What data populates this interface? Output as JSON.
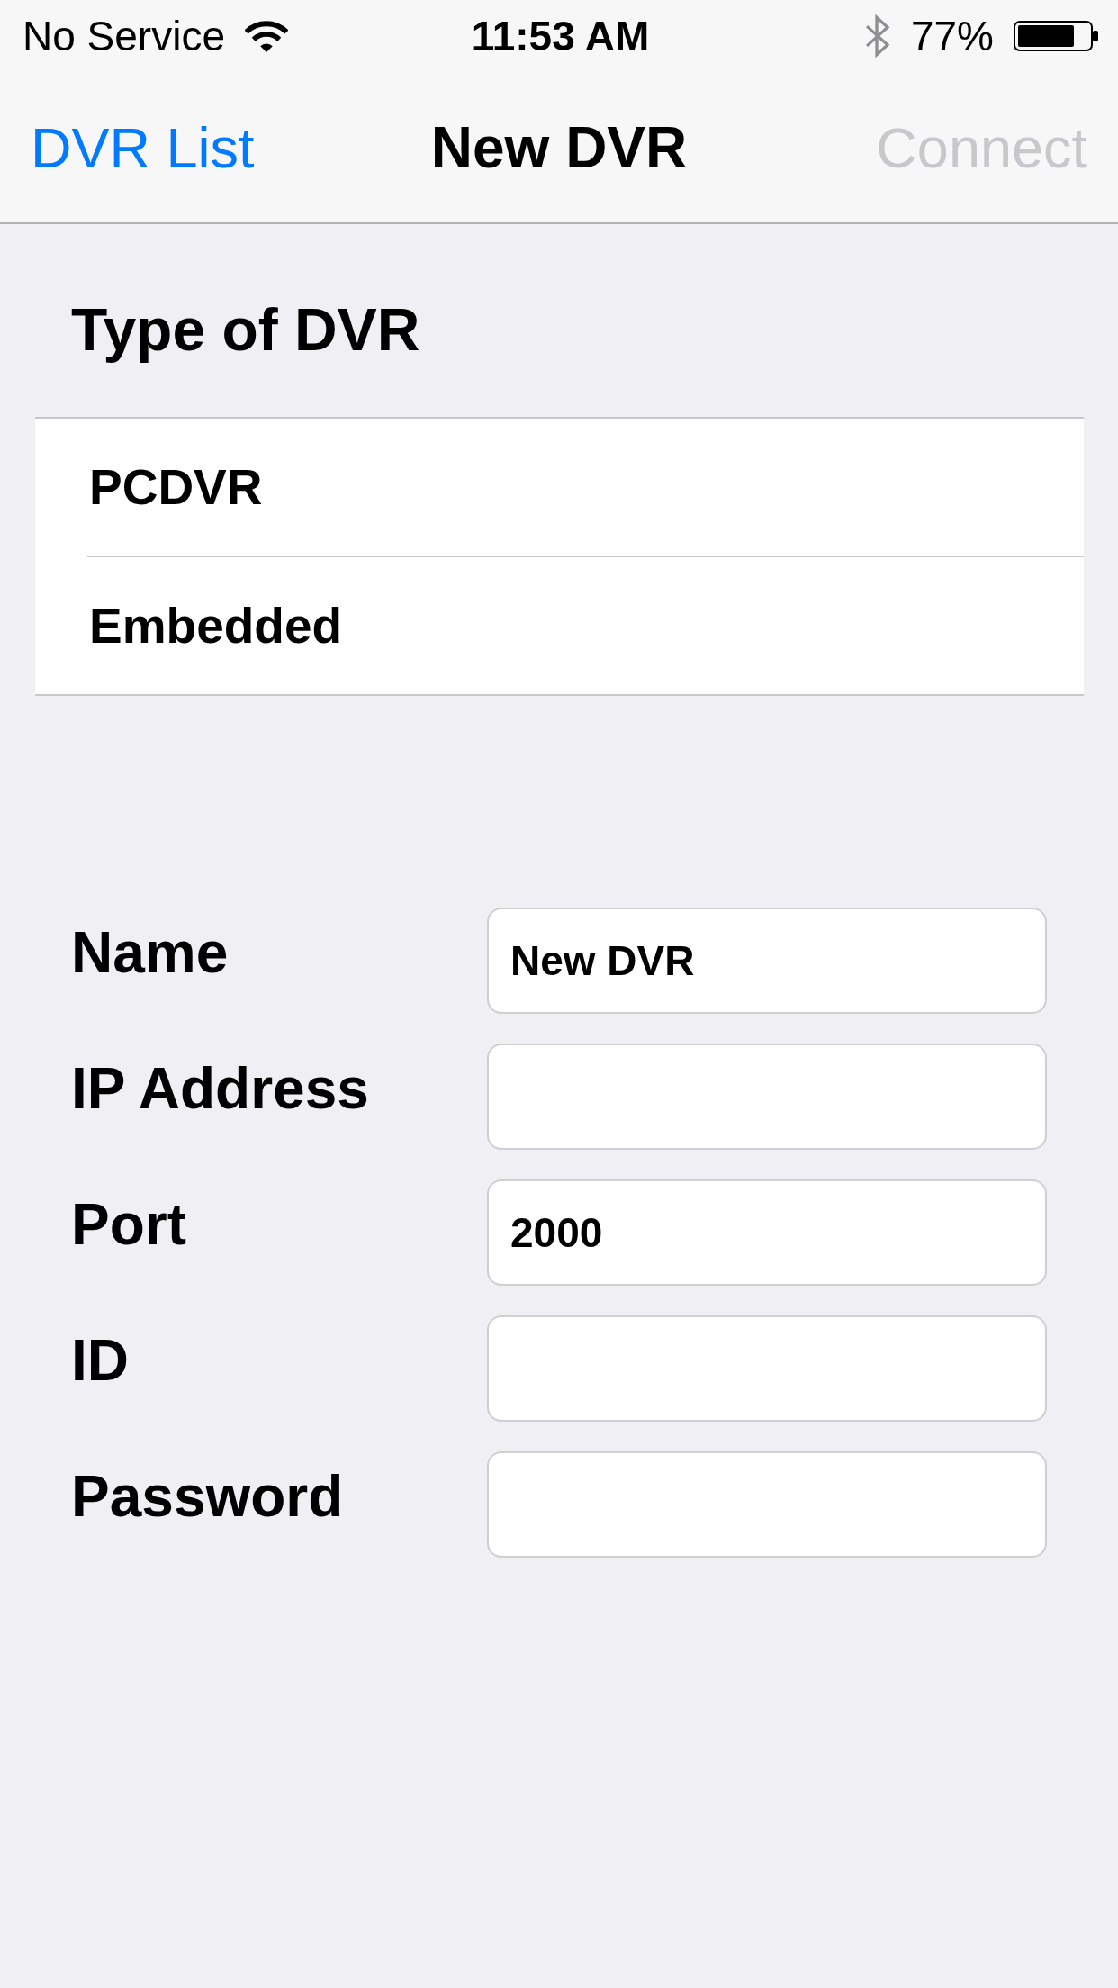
{
  "status_bar": {
    "carrier": "No Service",
    "time": "11:53 AM",
    "battery": "77%"
  },
  "nav_bar": {
    "back": {
      "label": "DVR List"
    },
    "title": "New DVR",
    "action": {
      "label": "Connect",
      "disabled": true
    }
  },
  "type_section": {
    "header": "Type of DVR",
    "options": [
      {
        "label": "PCDVR"
      },
      {
        "label": "Embedded"
      }
    ]
  },
  "form": {
    "fields": [
      {
        "label": "Name",
        "value": "New DVR"
      },
      {
        "label": "IP Address"
      },
      {
        "label": "Port",
        "value": "2000"
      },
      {
        "label": "ID"
      },
      {
        "label": "Password"
      }
    ]
  }
}
